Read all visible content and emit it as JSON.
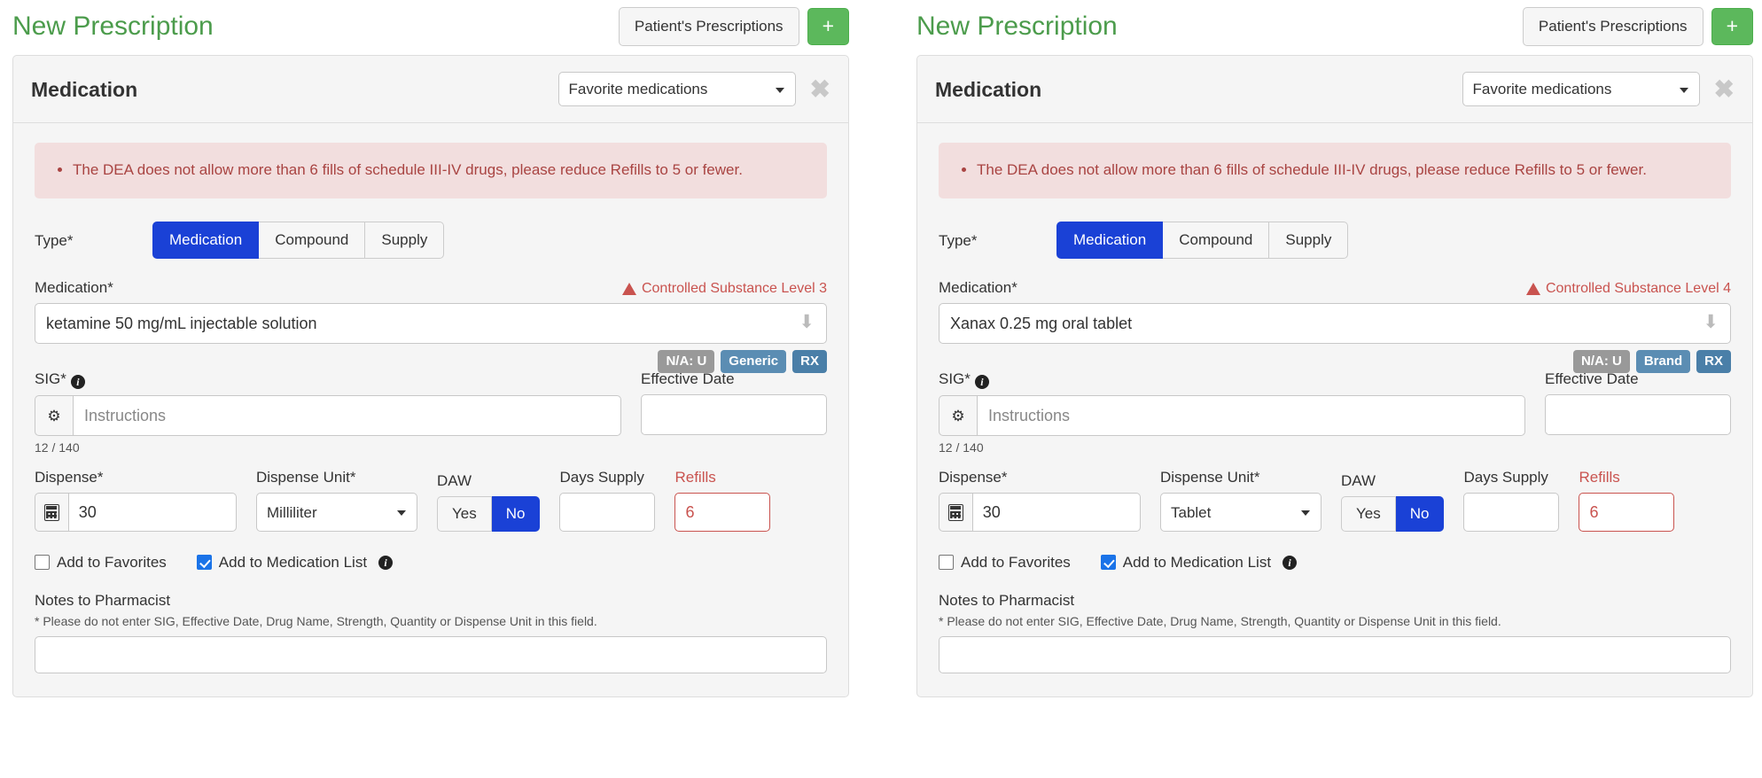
{
  "colors": {
    "title_green": "#4c9c4c",
    "primary_blue": "#1a41d6",
    "danger_red": "#c9534f",
    "alert_bg": "#f2dede",
    "alert_text": "#a94442",
    "badge_gray": "#999999",
    "badge_steel": "#5b8db3",
    "badge_blue": "#4a7fa8"
  },
  "panels": [
    {
      "header": {
        "title": "New Prescription",
        "patient_prescriptions_label": "Patient's Prescriptions",
        "add_label": "+"
      },
      "card": {
        "title": "Medication",
        "favorites_select": {
          "value": "Favorite medications",
          "options": [
            "Favorite medications"
          ]
        },
        "close_label": "✖"
      },
      "alert": {
        "messages": [
          "The DEA does not allow more than 6 fills of schedule III-IV drugs, please reduce Refills to 5 or fewer."
        ]
      },
      "type": {
        "label": "Type*",
        "options": [
          "Medication",
          "Compound",
          "Supply"
        ],
        "selected": "Medication"
      },
      "medication": {
        "label": "Medication*",
        "warning": "Controlled Substance Level 3",
        "value": "ketamine 50 mg/mL injectable solution",
        "badges": [
          "N/A: U",
          "Generic",
          "RX"
        ]
      },
      "sig": {
        "label": "SIG*",
        "gear_icon": "gear-icon",
        "info_icon": "info-icon",
        "placeholder": "Instructions",
        "counter": "12 / 140"
      },
      "effective_date": {
        "label": "Effective Date",
        "value": ""
      },
      "dispense": {
        "label": "Dispense*",
        "icon": "calculator-icon",
        "value": "30"
      },
      "dispense_unit": {
        "label": "Dispense Unit*",
        "value": "Milliliter",
        "options": [
          "Milliliter"
        ]
      },
      "daw": {
        "label": "DAW",
        "options": [
          "Yes",
          "No"
        ],
        "selected": "No"
      },
      "days_supply": {
        "label": "Days Supply",
        "value": ""
      },
      "refills": {
        "label": "Refills",
        "value": "6"
      },
      "checkboxes": [
        {
          "label": "Add to Favorites",
          "checked": false,
          "info": false
        },
        {
          "label": "Add to Medication List",
          "checked": true,
          "info": true
        }
      ],
      "notes": {
        "title": "Notes to Pharmacist",
        "hint": "* Please do not enter SIG, Effective Date, Drug Name, Strength, Quantity or Dispense Unit in this field.",
        "value": ""
      }
    },
    {
      "header": {
        "title": "New Prescription",
        "patient_prescriptions_label": "Patient's Prescriptions",
        "add_label": "+"
      },
      "card": {
        "title": "Medication",
        "favorites_select": {
          "value": "Favorite medications",
          "options": [
            "Favorite medications"
          ]
        },
        "close_label": "✖"
      },
      "alert": {
        "messages": [
          "The DEA does not allow more than 6 fills of schedule III-IV drugs, please reduce Refills to 5 or fewer."
        ]
      },
      "type": {
        "label": "Type*",
        "options": [
          "Medication",
          "Compound",
          "Supply"
        ],
        "selected": "Medication"
      },
      "medication": {
        "label": "Medication*",
        "warning": "Controlled Substance Level 4",
        "value": "Xanax 0.25 mg oral tablet",
        "badges": [
          "N/A: U",
          "Brand",
          "RX"
        ]
      },
      "sig": {
        "label": "SIG*",
        "gear_icon": "gear-icon",
        "info_icon": "info-icon",
        "placeholder": "Instructions",
        "counter": "12 / 140"
      },
      "effective_date": {
        "label": "Effective Date",
        "value": ""
      },
      "dispense": {
        "label": "Dispense*",
        "icon": "calculator-icon",
        "value": "30"
      },
      "dispense_unit": {
        "label": "Dispense Unit*",
        "value": "Tablet",
        "options": [
          "Tablet"
        ]
      },
      "daw": {
        "label": "DAW",
        "options": [
          "Yes",
          "No"
        ],
        "selected": "No"
      },
      "days_supply": {
        "label": "Days Supply",
        "value": ""
      },
      "refills": {
        "label": "Refills",
        "value": "6"
      },
      "checkboxes": [
        {
          "label": "Add to Favorites",
          "checked": false,
          "info": false
        },
        {
          "label": "Add to Medication List",
          "checked": true,
          "info": true
        }
      ],
      "notes": {
        "title": "Notes to Pharmacist",
        "hint": "* Please do not enter SIG, Effective Date, Drug Name, Strength, Quantity or Dispense Unit in this field.",
        "value": ""
      }
    }
  ]
}
